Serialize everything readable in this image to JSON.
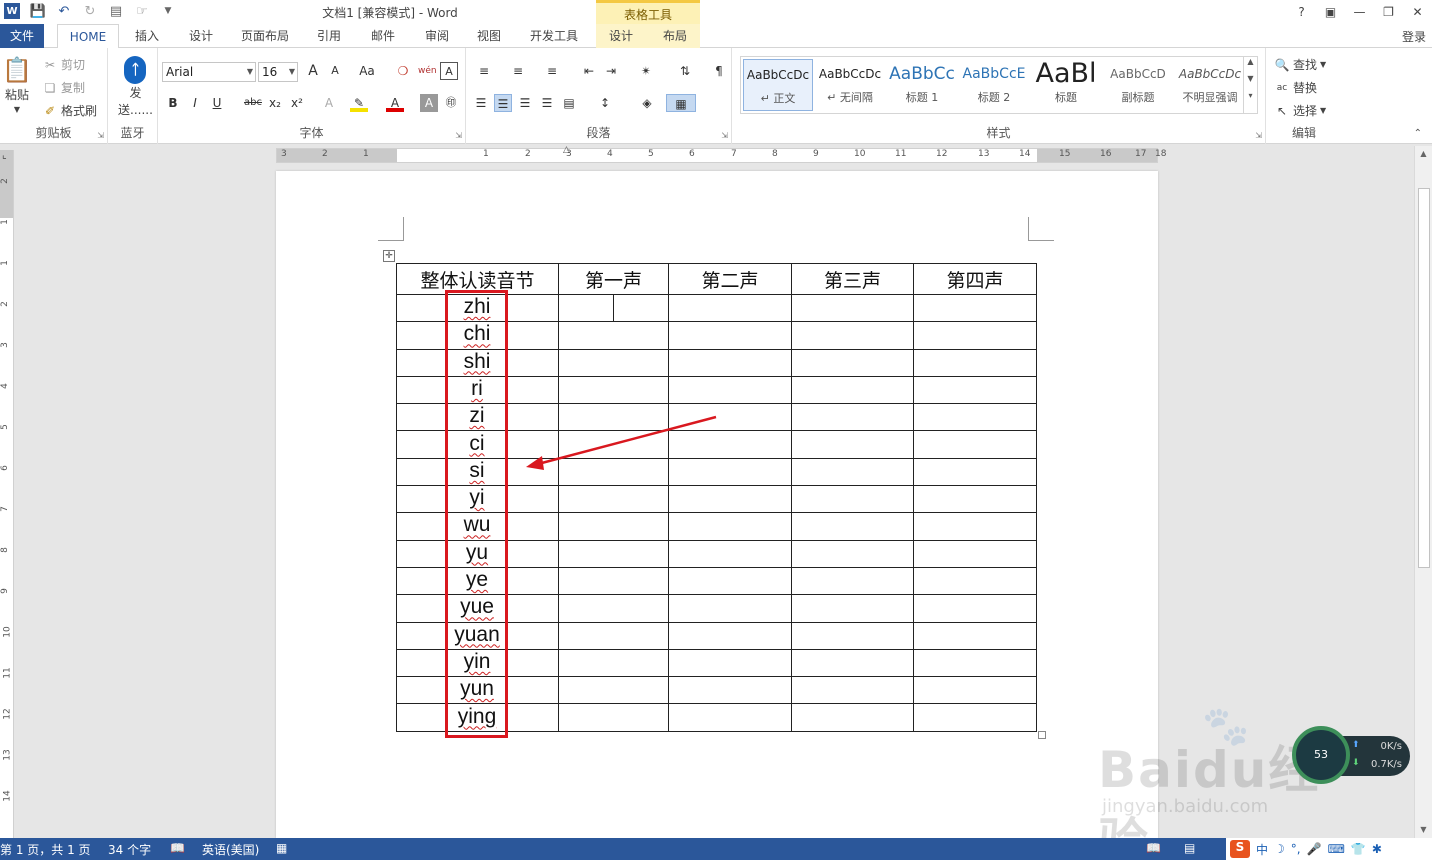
{
  "window": {
    "title": "文档1 [兼容模式] - Word",
    "context_band": "表格工具",
    "help": "?",
    "sign_in": "登录"
  },
  "tabs": {
    "file": "文件",
    "home": "HOME",
    "insert": "插入",
    "design": "设计",
    "layout": "页面布局",
    "references": "引用",
    "mailings": "邮件",
    "review": "审阅",
    "view": "视图",
    "developer": "开发工具",
    "table_design": "设计",
    "table_layout": "布局"
  },
  "ribbon": {
    "clipboard": {
      "paste": "粘贴",
      "cut": "剪切",
      "copy": "复制",
      "format_painter": "格式刷",
      "label": "剪贴板"
    },
    "bluetooth": {
      "send": "发",
      "send2": "送......",
      "label": "蓝牙"
    },
    "font": {
      "name": "Arial",
      "size": "16",
      "label": "字体",
      "bold": "B",
      "italic": "I",
      "underline": "U",
      "strike": "abc",
      "sub": "x₂",
      "sup": "x²",
      "case": "Aa",
      "grow": "A",
      "shrink": "A"
    },
    "paragraph": {
      "label": "段落"
    },
    "styles": {
      "label": "样式",
      "items": [
        {
          "preview": "AaBbCcDc",
          "name": "↵ 正文"
        },
        {
          "preview": "AaBbCcDc",
          "name": "↵ 无间隔"
        },
        {
          "preview": "AaBbCc",
          "name": "标题 1"
        },
        {
          "preview": "AaBbCcE",
          "name": "标题 2"
        },
        {
          "preview": "AaBl",
          "name": "标题"
        },
        {
          "preview": "AaBbCcD",
          "name": "副标题"
        },
        {
          "preview": "AaBbCcDc",
          "name": "不明显强调"
        }
      ]
    },
    "editing": {
      "find": "查找",
      "replace": "替换",
      "select": "选择",
      "label": "编辑"
    }
  },
  "ruler": {
    "h_numbers": [
      "3",
      "2",
      "1",
      "1",
      "2",
      "3",
      "4",
      "5",
      "6",
      "7",
      "8",
      "9",
      "10",
      "11",
      "12",
      "13",
      "14",
      "15",
      "16",
      "17",
      "18"
    ],
    "v_numbers": [
      "2",
      "1",
      "1",
      "2",
      "3",
      "4",
      "5",
      "6",
      "7",
      "8",
      "9",
      "10",
      "11",
      "12",
      "13",
      "14"
    ]
  },
  "table": {
    "headers": [
      "整体认读音节",
      "第一声",
      "第二声",
      "第三声",
      "第四声"
    ],
    "syllables": [
      "zhi",
      "chi",
      "shi",
      "ri",
      "zi",
      "ci",
      "si",
      "yi",
      "wu",
      "yu",
      "ye",
      "yue",
      "yuan",
      "yin",
      "yun",
      "ying"
    ]
  },
  "watermark": {
    "main": "Baidu经验",
    "sub": "jingyan.baidu.com"
  },
  "net_speed": {
    "upload": "0K/s",
    "download": "0.7K/s",
    "badge": "53"
  },
  "status": {
    "page": "第 1 页，共 1 页",
    "words": "34 个字",
    "language": "英语(美国)"
  },
  "tray": {
    "ime": "中"
  },
  "colors": {
    "brand": "#2b579a",
    "annotation": "#d9181f",
    "context_band": "#fdf1b6"
  }
}
